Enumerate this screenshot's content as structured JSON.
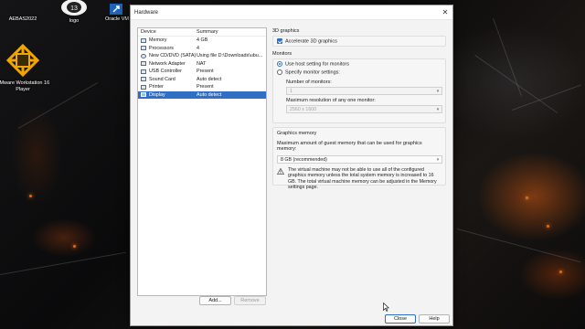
{
  "desktop": {
    "icons": [
      {
        "label": "AEBAS2022",
        "icon": "app-icon"
      },
      {
        "label": "logo",
        "icon": "logo-icon"
      },
      {
        "label": "Oracle VM",
        "icon": "virtualbox-icon"
      },
      {
        "label": "VMware Workstation 16 Player",
        "icon": "vmware-icon"
      }
    ]
  },
  "dialog": {
    "title": "Hardware",
    "device_list": {
      "headers": {
        "device": "Device",
        "summary": "Summary"
      },
      "rows": [
        {
          "device": "Memory",
          "summary": "4 GB",
          "icon": "memory-icon"
        },
        {
          "device": "Processors",
          "summary": "4",
          "icon": "processor-icon"
        },
        {
          "device": "New CD/DVD (SATA)",
          "summary": "Using file D:\\Downloads\\ubu...",
          "icon": "cd-dvd-icon"
        },
        {
          "device": "Network Adapter",
          "summary": "NAT",
          "icon": "network-adapter-icon"
        },
        {
          "device": "USB Controller",
          "summary": "Present",
          "icon": "usb-icon"
        },
        {
          "device": "Sound Card",
          "summary": "Auto detect",
          "icon": "sound-card-icon"
        },
        {
          "device": "Printer",
          "summary": "Present",
          "icon": "printer-icon"
        },
        {
          "device": "Display",
          "summary": "Auto detect",
          "icon": "display-icon",
          "selected": true
        }
      ]
    },
    "add_label": "Add...",
    "remove_label": "Remove",
    "graphics3d": {
      "title": "3D graphics",
      "accelerate_label": "Accelerate 3D graphics",
      "accelerate_checked": true
    },
    "monitors": {
      "title": "Monitors",
      "use_host_label": "Use host setting for monitors",
      "specify_label": "Specify monitor settings:",
      "number_label": "Number of monitors:",
      "number_value": "1",
      "max_res_label": "Maximum resolution of any one monitor:",
      "max_res_value": "2560 x 1600"
    },
    "graphics_memory": {
      "title": "Graphics memory",
      "desc": "Maximum amount of guest memory that can be used for graphics memory:",
      "value": "8 GB (recommended)",
      "warning": "The virtual machine may not be able to use all of the configured graphics memory unless the total system memory is increased to 16 GB. The total virtual machine memory can be adjusted in the Memory settings page."
    },
    "close_label": "Close",
    "help_label": "Help"
  }
}
